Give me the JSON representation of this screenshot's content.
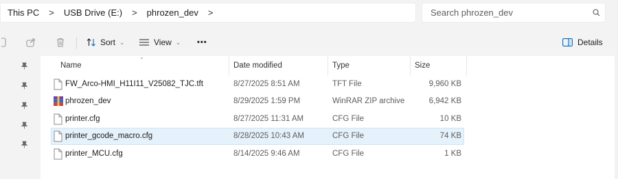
{
  "breadcrumb": {
    "items": [
      "This PC",
      "USB Drive (E:)",
      "phrozen_dev"
    ],
    "separator": ">"
  },
  "search": {
    "placeholder": "Search phrozen_dev"
  },
  "toolbar": {
    "sort_label": "Sort",
    "view_label": "View",
    "more_label": "•••",
    "details_label": "Details"
  },
  "columns": {
    "name": "Name",
    "date": "Date modified",
    "type": "Type",
    "size": "Size"
  },
  "files": [
    {
      "name": "FW_Arco-HMI_H11I11_V25082_TJC.tft",
      "date": "8/27/2025 8:51 AM",
      "type": "TFT File",
      "size": "9,960 KB",
      "icon": "document-icon",
      "selected": false
    },
    {
      "name": "phrozen_dev",
      "date": "8/29/2025 1:59 PM",
      "type": "WinRAR ZIP archive",
      "size": "6,942 KB",
      "icon": "winrar-archive-icon",
      "selected": false
    },
    {
      "name": "printer.cfg",
      "date": "8/27/2025 11:31 AM",
      "type": "CFG File",
      "size": "10 KB",
      "icon": "document-icon",
      "selected": false
    },
    {
      "name": "printer_gcode_macro.cfg",
      "date": "8/28/2025 10:43 AM",
      "type": "CFG File",
      "size": "74 KB",
      "icon": "document-icon",
      "selected": true
    },
    {
      "name": "printer_MCU.cfg",
      "date": "8/14/2025 9:46 AM",
      "type": "CFG File",
      "size": "1 KB",
      "icon": "document-icon",
      "selected": false
    }
  ],
  "colors": {
    "selection_bg": "#e5f1fb",
    "selection_border": "#cce4f7",
    "accent": "#0067c0"
  }
}
